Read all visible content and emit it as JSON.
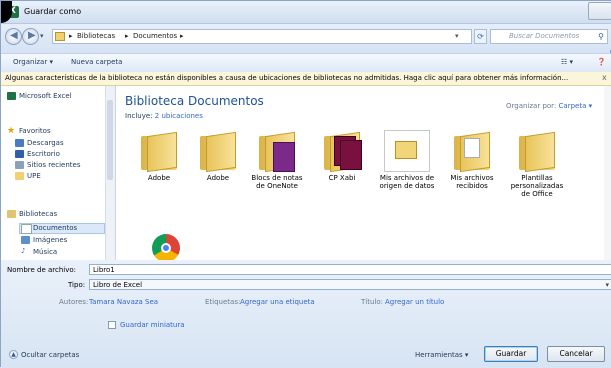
{
  "window": {
    "title": "Guardar como",
    "close": "⊠"
  },
  "address": {
    "crumbs": [
      "Bibliotecas",
      "Documentos"
    ],
    "search_placeholder": "Buscar Documentos"
  },
  "toolbar": {
    "organize": "Organizar ▾",
    "new_folder": "Nueva carpeta"
  },
  "infobar": {
    "text": "Algunas características de la biblioteca no están disponibles a causa de ubicaciones de bibliotecas no admitidas. Haga clic aquí para obtener más información...",
    "close": "x"
  },
  "nav": {
    "excel": "Microsoft Excel",
    "favorites": "Favoritos",
    "fav_items": [
      "Descargas",
      "Escritorio",
      "Sitios recientes",
      "UPE"
    ],
    "libraries": "Bibliotecas",
    "lib_items": [
      "Documentos",
      "Imágenes",
      "Música"
    ]
  },
  "library": {
    "title": "Biblioteca Documentos",
    "includes_prefix": "Incluye:",
    "includes_link": "2 ubicaciones",
    "arrange_prefix": "Organizar por:",
    "arrange_value": "Carpeta ▾"
  },
  "files": [
    {
      "label": "Adobe"
    },
    {
      "label": "Adobe"
    },
    {
      "label": "Blocs de notas de OneNote"
    },
    {
      "label": "CP Xabi"
    },
    {
      "label": "Mis archivos de origen de datos"
    },
    {
      "label": "Mis archivos recibidos"
    },
    {
      "label": "Plantillas personalizadas de Office"
    }
  ],
  "form": {
    "filename_label": "Nombre de archivo:",
    "filename_value": "Libro1",
    "type_label": "Tipo:",
    "type_value": "Libro de Excel",
    "authors_label": "Autores:",
    "authors_value": "Tamara Navaza Sea",
    "tags_label": "Etiquetas:",
    "tags_value": "Agregar una etiqueta",
    "title_label": "Título:",
    "title_value": "Agregar un título",
    "thumbnail_label": "Guardar miniatura"
  },
  "footer": {
    "hide_folders": "Ocultar carpetas",
    "tools": "Herramientas ▾",
    "save": "Guardar",
    "cancel": "Cancelar"
  },
  "colors": {
    "link": "#3366cc",
    "title": "#1e5294",
    "folder": "#f0d070",
    "excel": "#1e7145"
  }
}
